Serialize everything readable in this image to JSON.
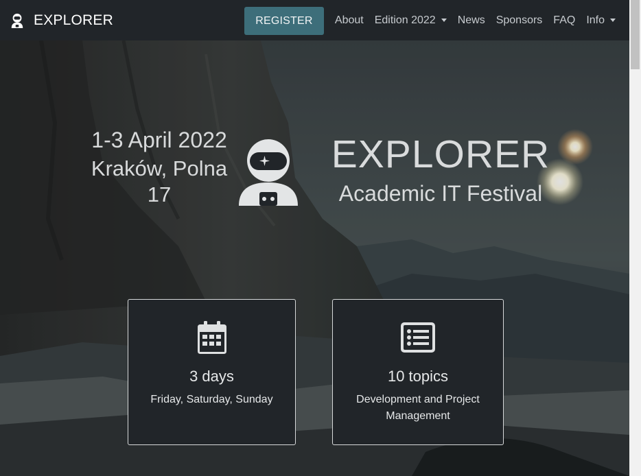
{
  "navbar": {
    "brand": "EXPLORER",
    "register_label": "REGISTER",
    "links": [
      {
        "label": "About"
      },
      {
        "label": "Edition 2022",
        "dropdown": true
      },
      {
        "label": "News"
      },
      {
        "label": "Sponsors"
      },
      {
        "label": "FAQ"
      },
      {
        "label": "Info",
        "dropdown": true
      }
    ]
  },
  "hero": {
    "dates": "1-3 April 2022",
    "place": "Kraków, Polna 17",
    "title": "EXPLORER",
    "subtitle": "Academic IT Festival"
  },
  "cards": [
    {
      "icon": "calendar-icon",
      "value": "3 days",
      "description": "Friday, Saturday, Sunday"
    },
    {
      "icon": "list-icon",
      "value": "10 topics",
      "description": "Development and Project Management"
    }
  ],
  "colors": {
    "navbar_bg": "#212529",
    "register_bg": "#3d6e7a",
    "card_bg": "#212529"
  }
}
